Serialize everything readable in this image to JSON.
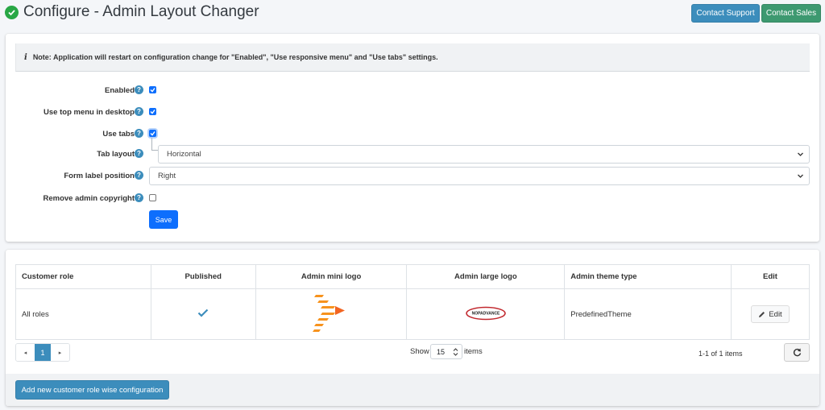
{
  "header": {
    "title": "Configure - Admin Layout Changer",
    "title_icon": "check-circle-icon",
    "contact_support": "Contact Support",
    "contact_sales": "Contact Sales"
  },
  "note": {
    "text": "Note: Application will restart on configuration change for \"Enabled\", \"Use responsive menu\" and \"Use tabs\" settings."
  },
  "settings": {
    "enabled": {
      "label": "Enabled",
      "checked": true
    },
    "use_top_menu": {
      "label": "Use top menu in desktop",
      "checked": true
    },
    "use_tabs": {
      "label": "Use tabs",
      "checked": true
    },
    "tab_layout": {
      "label": "Tab layout",
      "value": "Horizontal"
    },
    "form_label_position": {
      "label": "Form label position",
      "value": "Right"
    },
    "remove_copyright": {
      "label": "Remove admin copyright",
      "checked": false
    },
    "save_label": "Save"
  },
  "grid": {
    "columns": [
      "Customer role",
      "Published",
      "Admin mini logo",
      "Admin large logo",
      "Admin theme type",
      "Edit"
    ],
    "rows": [
      {
        "customer_role": "All roles",
        "published": true,
        "theme_type": "PredefinedTheme",
        "edit_label": "Edit",
        "large_logo_text": "NOPADVANCE"
      }
    ],
    "pager": {
      "prev": "◂",
      "current": "1",
      "next": "▸"
    },
    "show_label": "Show",
    "page_size": "15",
    "items_label": "items",
    "range": "1-1 of 1 items"
  },
  "footer": {
    "add_label": "Add new customer role wise configuration"
  },
  "colors": {
    "primary": "#3c8dbc",
    "success": "#3d9970",
    "checkbox": "#0d6efd"
  }
}
